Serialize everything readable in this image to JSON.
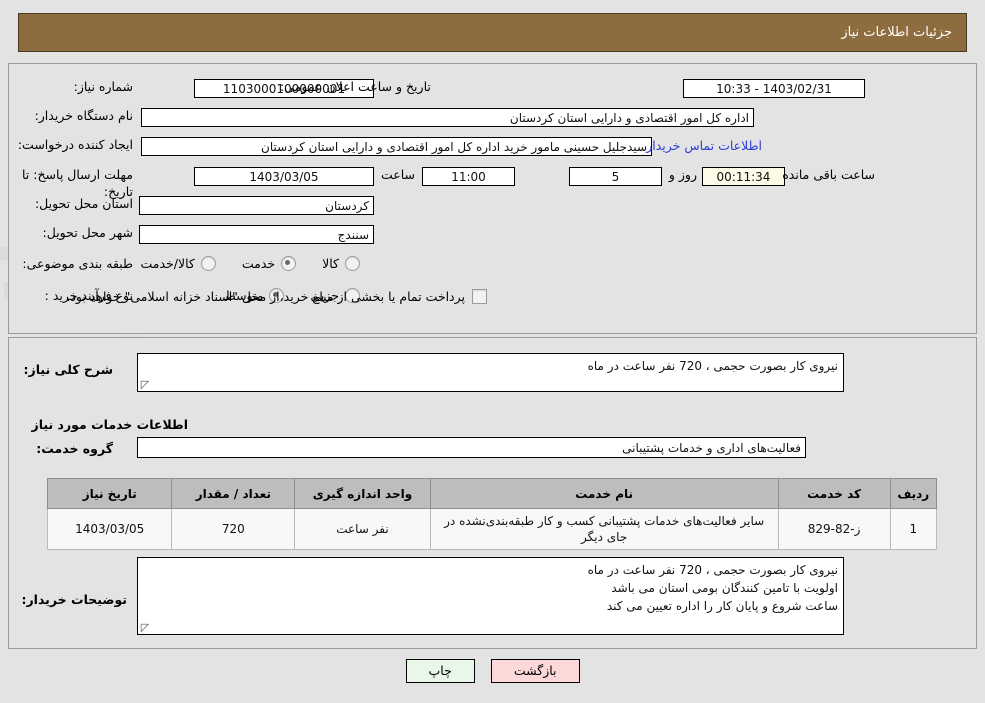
{
  "header": {
    "title": "جزئیات اطلاعات نیاز"
  },
  "colors": {
    "header_bg": "#8d6c3f",
    "page_bg": "#e3e3e3",
    "link": "#2a3fd4",
    "countdown_bg": "#fbfbe8",
    "table_header_bg": "#bdbdbd",
    "btn_print_bg": "#e9f7e9",
    "btn_back_bg": "#fcd8d8"
  },
  "top_section": {
    "need_number": {
      "label": "شماره نیاز:",
      "value": "1103000100000001"
    },
    "announce_datetime": {
      "label": "تاریخ و ساعت اعلان عمومی:",
      "value": "1403/02/31 - 10:33"
    },
    "buyer_org": {
      "label": "نام دستگاه خریدار:",
      "value": "اداره کل امور اقتصادی و دارایی استان کردستان"
    },
    "request_creator": {
      "label": "ایجاد کننده درخواست:",
      "value": "سیدجلیل حسینی مامور خرید اداره کل امور اقتصادی و دارایی استان کردستان",
      "contact_link": "اطلاعات تماس خریدار"
    },
    "deadline": {
      "label": "مهلت ارسال پاسخ: تا تاریخ:",
      "date": "1403/03/05",
      "time_label": "ساعت",
      "time": "11:00",
      "days": "5",
      "days_label": "روز و",
      "countdown": "00:11:34",
      "remaining_label": "ساعت باقی مانده"
    },
    "delivery_province": {
      "label": "استان محل تحویل:",
      "value": "کردستان"
    },
    "delivery_city": {
      "label": "شهر محل تحویل:",
      "value": "سنندج"
    },
    "subject_category": {
      "label": "طبقه بندی موضوعی:",
      "options": [
        {
          "label": "کالا",
          "selected": false
        },
        {
          "label": "خدمت",
          "selected": true
        },
        {
          "label": "کالا/خدمت",
          "selected": false
        }
      ]
    },
    "purchase_process": {
      "label": "نوع فرآیند خرید :",
      "options": [
        {
          "label": "جزیی",
          "selected": false
        },
        {
          "label": "متوسط",
          "selected": true
        }
      ],
      "treasury_checkbox": {
        "checked": false,
        "text": "پرداخت تمام یا بخشی از مبلغ خرید،از محل \"اسناد خزانه اسلامی\" خواهد بود."
      }
    }
  },
  "middle_section": {
    "general_need": {
      "label": "شرح کلی نیاز:",
      "value": "نیروی کار بصورت حجمی ، 720 نفر ساعت در ماه"
    },
    "services_heading": "اطلاعات خدمات مورد نیاز",
    "service_group": {
      "label": "گروه خدمت:",
      "value": "فعالیت‌های اداری و خدمات پشتیبانی"
    },
    "table": {
      "columns": [
        "ردیف",
        "کد خدمت",
        "نام خدمت",
        "واحد اندازه گیری",
        "تعداد / مقدار",
        "تاریخ نیاز"
      ],
      "rows": [
        {
          "row_no": "1",
          "service_code": "ز-82-829",
          "service_name": "سایر فعالیت‌های خدمات پشتیبانی کسب و کار طبقه‌بندی‌نشده در جای دیگر",
          "unit": "نفر ساعت",
          "quantity": "720",
          "need_date": "1403/03/05"
        }
      ]
    },
    "buyer_notes": {
      "label": "توضیحات خریدار:",
      "value": "نیروی کار بصورت حجمی ، 720 نفر ساعت در ماه\nاولویت با تامین کنندگان بومی استان می باشد\nساعت شروع و پایان کار را اداره تعیین می کند"
    }
  },
  "footer": {
    "print_button": "چاپ",
    "back_button": "بازگشت"
  }
}
